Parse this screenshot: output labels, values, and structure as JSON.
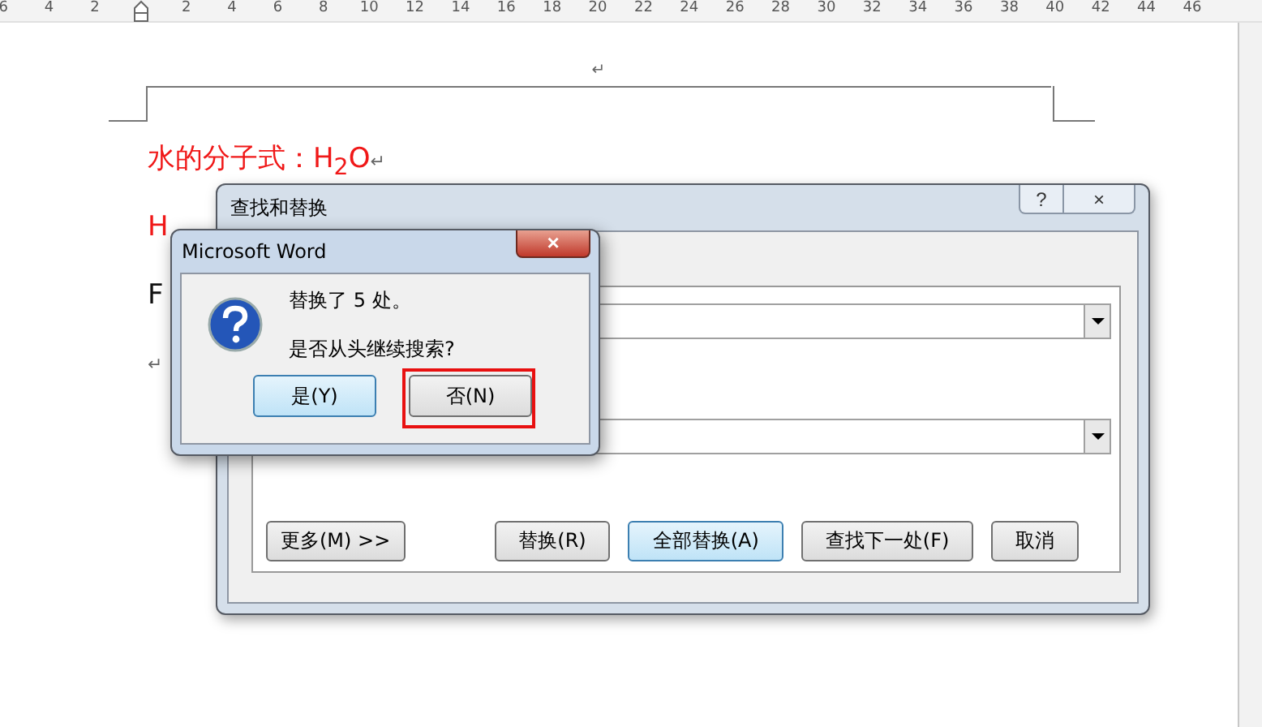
{
  "ruler": {
    "left_numbers": [
      "6",
      "4",
      "2"
    ],
    "right_numbers": [
      "2",
      "4",
      "6",
      "8",
      "10",
      "12",
      "14",
      "16",
      "18",
      "20",
      "22",
      "24",
      "26",
      "28",
      "30",
      "32",
      "34",
      "36",
      "38",
      "40",
      "42",
      "44",
      "46"
    ]
  },
  "document": {
    "header_mark": "↵",
    "lines": [
      {
        "kind": "formula",
        "text": "水的分子式：H$_{2}$O",
        "mark": "↵"
      },
      {
        "kind": "partial",
        "text": "H"
      },
      {
        "kind": "partial_black",
        "text": "F"
      },
      {
        "kind": "blank",
        "text": "↵"
      }
    ]
  },
  "find_dialog": {
    "title": "查找和替换",
    "help": "?",
    "close": "×",
    "buttons": [
      {
        "label": "更多(M) >>",
        "default": false,
        "kind": "left"
      },
      {
        "label": "替换(R)",
        "default": false,
        "kind": "right"
      },
      {
        "label": "全部替换(A)",
        "default": true,
        "kind": "right"
      },
      {
        "label": "查找下一处(F)",
        "default": false,
        "kind": "right"
      },
      {
        "label": "取消",
        "default": false,
        "kind": "right"
      }
    ]
  },
  "message_box": {
    "title": "Microsoft Word",
    "close": "×",
    "lines": [
      "替换了 5 处。",
      "是否从头继续搜索?"
    ],
    "buttons": [
      {
        "label": "是(Y)",
        "default": true,
        "highlighted": false
      },
      {
        "label": "否(N)",
        "default": false,
        "highlighted": true
      }
    ]
  }
}
